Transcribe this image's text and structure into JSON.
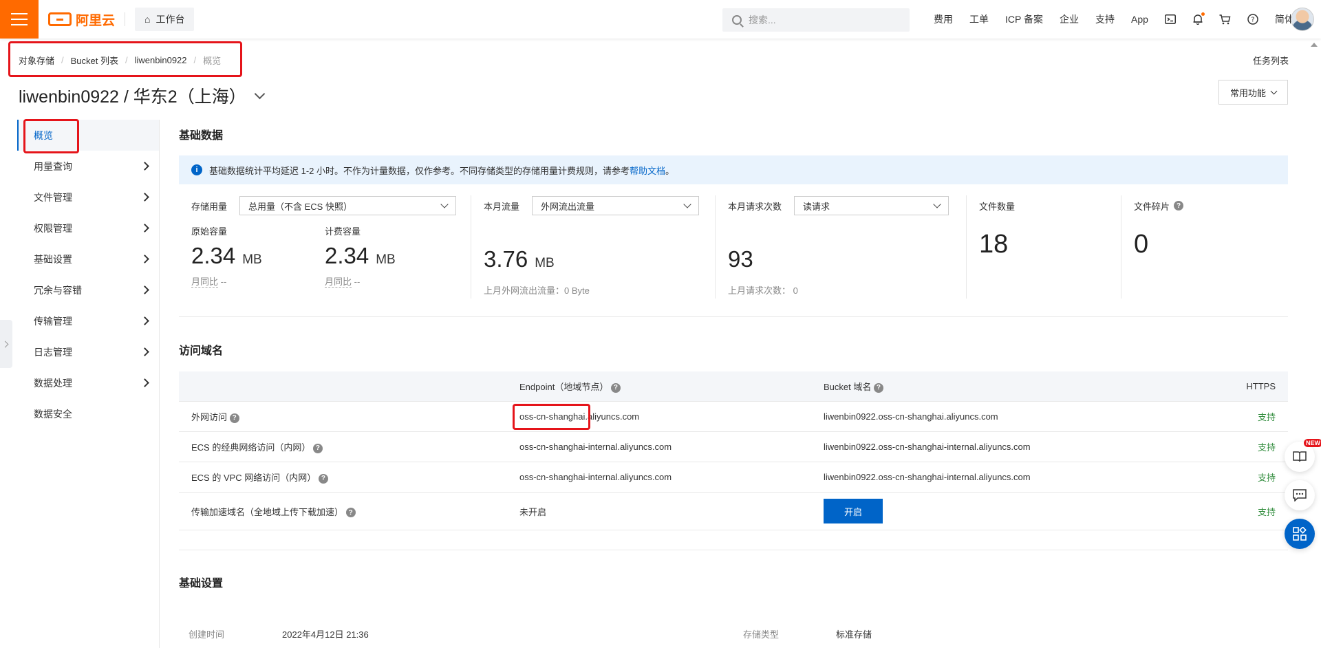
{
  "topbar": {
    "brand": "阿里云",
    "workbench": "工作台",
    "search_placeholder": "搜索...",
    "nav": [
      "费用",
      "工单",
      "ICP 备案",
      "企业",
      "支持",
      "App"
    ],
    "lang": "简体",
    "icons": [
      "terminal-icon",
      "bell-icon",
      "cart-icon",
      "help-icon"
    ]
  },
  "breadcrumb": [
    "对象存储",
    "Bucket 列表",
    "liwenbin0922",
    "概览"
  ],
  "task_list": "任务列表",
  "page_title": "liwenbin0922 / 华东2（上海）",
  "common_btn": "常用功能",
  "sidebar": [
    {
      "label": "概览",
      "active": true,
      "chevron": false
    },
    {
      "label": "用量查询",
      "chevron": true
    },
    {
      "label": "文件管理",
      "chevron": true
    },
    {
      "label": "权限管理",
      "chevron": true
    },
    {
      "label": "基础设置",
      "chevron": true
    },
    {
      "label": "冗余与容错",
      "chevron": true
    },
    {
      "label": "传输管理",
      "chevron": true
    },
    {
      "label": "日志管理",
      "chevron": true
    },
    {
      "label": "数据处理",
      "chevron": true
    },
    {
      "label": "数据安全",
      "chevron": false
    }
  ],
  "basic_data": {
    "title": "基础数据",
    "notice_text": "基础数据统计平均延迟 1-2 小时。不作为计量数据，仅作参考。不同存储类型的存储用量计费规则，请参考",
    "notice_link": "帮助文档",
    "notice_end": "。",
    "storage": {
      "label": "存储用量",
      "select": "总用量（不含 ECS 快照）",
      "raw_label": "原始容量",
      "raw_value": "2.34",
      "raw_unit": "MB",
      "raw_sub": "月同比",
      "raw_sub_val": "--",
      "bill_label": "计费容量",
      "bill_value": "2.34",
      "bill_unit": "MB",
      "bill_sub": "月同比",
      "bill_sub_val": "--"
    },
    "traffic": {
      "label": "本月流量",
      "select": "外网流出流量",
      "value": "3.76",
      "unit": "MB",
      "sub": "上月外网流出流量：0 Byte"
    },
    "requests": {
      "label": "本月请求次数",
      "select": "读请求",
      "value": "93",
      "sub": "上月请求次数：",
      "sub_val": "0"
    },
    "files": {
      "label": "文件数量",
      "value": "18"
    },
    "fragments": {
      "label": "文件碎片",
      "value": "0"
    }
  },
  "domains": {
    "title": "访问域名",
    "headers": [
      "",
      "Endpoint（地域节点）",
      "Bucket 域名",
      "HTTPS"
    ],
    "rows": [
      {
        "name": "外网访问",
        "endpoint": "oss-cn-shanghai.aliyuncs.com",
        "bucket": "liwenbin0922.oss-cn-shanghai.aliyuncs.com",
        "https": "支持"
      },
      {
        "name": "ECS 的经典网络访问（内网）",
        "endpoint": "oss-cn-shanghai-internal.aliyuncs.com",
        "bucket": "liwenbin0922.oss-cn-shanghai-internal.aliyuncs.com",
        "https": "支持"
      },
      {
        "name": "ECS 的 VPC 网络访问（内网）",
        "endpoint": "oss-cn-shanghai-internal.aliyuncs.com",
        "bucket": "liwenbin0922.oss-cn-shanghai-internal.aliyuncs.com",
        "https": "支持"
      },
      {
        "name": "传输加速域名（全地域上传下载加速）",
        "endpoint": "未开启",
        "button": "开启",
        "https": "支持"
      }
    ]
  },
  "basic_settings": {
    "title": "基础设置",
    "created_label": "创建时间",
    "created_value": "2022年4月12日 21:36",
    "storage_type_label": "存储类型",
    "storage_type_value": "标准存储"
  },
  "floating": {
    "new_badge": "NEW"
  },
  "colors": {
    "brand": "#ff6a00",
    "primary": "#0064c8",
    "annotation": "#e5141a",
    "success": "#2e8b3a"
  }
}
